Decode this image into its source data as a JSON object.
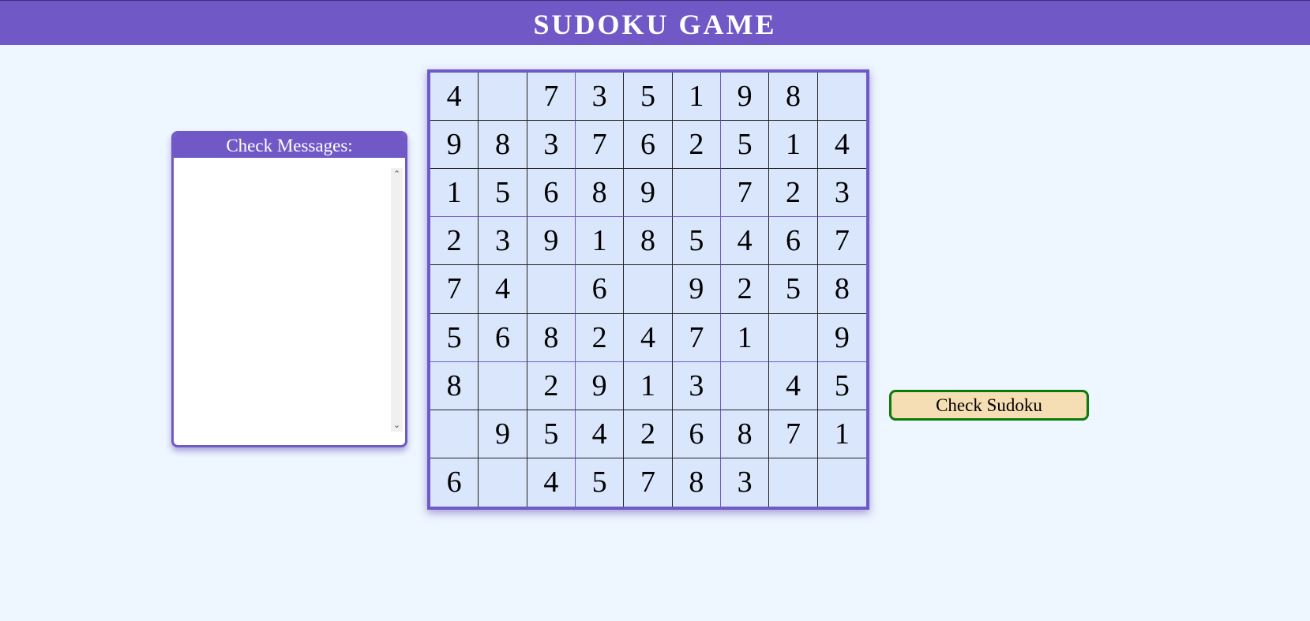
{
  "header": {
    "title": "SUDOKU GAME"
  },
  "messages_panel": {
    "title": "Check Messages:",
    "content": "",
    "scroll_up_icon": "chevron-up-icon",
    "scroll_down_icon": "chevron-down-icon"
  },
  "board": {
    "rows": [
      [
        "4",
        "",
        "7",
        "3",
        "5",
        "1",
        "9",
        "8",
        ""
      ],
      [
        "9",
        "8",
        "3",
        "7",
        "6",
        "2",
        "5",
        "1",
        "4"
      ],
      [
        "1",
        "5",
        "6",
        "8",
        "9",
        "",
        "7",
        "2",
        "3"
      ],
      [
        "2",
        "3",
        "9",
        "1",
        "8",
        "5",
        "4",
        "6",
        "7"
      ],
      [
        "7",
        "4",
        "",
        "6",
        "",
        "9",
        "2",
        "5",
        "8"
      ],
      [
        "5",
        "6",
        "8",
        "2",
        "4",
        "7",
        "1",
        "",
        "9"
      ],
      [
        "8",
        "",
        "2",
        "9",
        "1",
        "3",
        "",
        "4",
        "5"
      ],
      [
        "",
        "9",
        "5",
        "4",
        "2",
        "6",
        "8",
        "7",
        "1"
      ],
      [
        "6",
        "",
        "4",
        "5",
        "7",
        "8",
        "3",
        "",
        ""
      ]
    ]
  },
  "check_button": {
    "label": "Check Sudoku"
  },
  "colors": {
    "accent": "#7059c6",
    "background": "#eef6ff",
    "cell_background": "#d9e6fb",
    "button_background": "#f5deb3",
    "button_border": "#0a7a0a"
  }
}
